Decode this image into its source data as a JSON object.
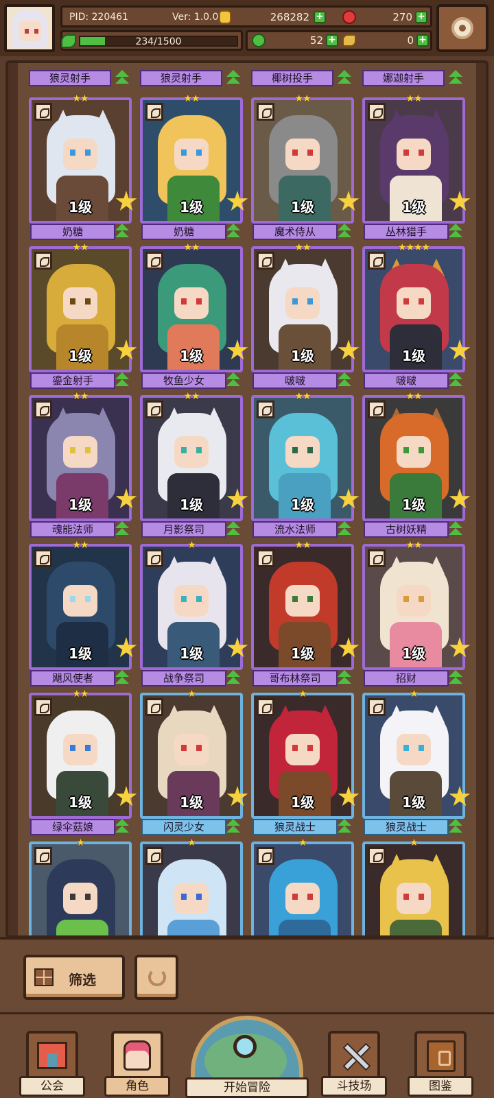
{
  "hud": {
    "pid": "PID: 220461",
    "version": "Ver: 1.0.0.0",
    "gold": "268282",
    "gems": "270",
    "xp_text": "234/1500",
    "xp_fraction": 0.156,
    "clover": "52",
    "keys": "0"
  },
  "top_strip": [
    "狼灵射手",
    "狼灵射手",
    "椰树投手",
    "娜迦射手"
  ],
  "cards": [
    {
      "name": "奶糖",
      "level": "1级",
      "stars": "★★",
      "rarity": "purple",
      "hair": "#dfe6f0",
      "body": "#6a4a38",
      "eye": "#3a9ad9",
      "ear": "#dfe6f0",
      "bg": "#5a4030"
    },
    {
      "name": "奶糖",
      "level": "1级",
      "stars": "★★",
      "rarity": "purple",
      "hair": "#f0c45a",
      "body": "#3f8a3a",
      "eye": "#3a9ad9",
      "ear": "",
      "bg": "#2e4d6a"
    },
    {
      "name": "魔术侍从",
      "level": "1级",
      "stars": "★★",
      "rarity": "purple",
      "hair": "#8a8a8a",
      "body": "#3c6a62",
      "eye": "#d23a3a",
      "ear": "",
      "bg": "#6a5a48"
    },
    {
      "name": "丛林猎手",
      "level": "1级",
      "stars": "★★",
      "rarity": "purple",
      "hair": "#5a3a6a",
      "body": "#efe4d4",
      "eye": "#d23a3a",
      "ear": "#5a3a6a",
      "bg": "#4a3a4a"
    },
    {
      "name": "鎏金射手",
      "level": "1级",
      "stars": "★★",
      "rarity": "purple",
      "hair": "#d8ac3a",
      "body": "#b8862a",
      "eye": "#6a4a12",
      "ear": "",
      "bg": "#5a4a2a"
    },
    {
      "name": "牧鱼少女",
      "level": "1级",
      "stars": "★★",
      "rarity": "purple",
      "hair": "#3a9a7a",
      "body": "#e07a5a",
      "eye": "#d23a3a",
      "ear": "",
      "bg": "#2e3a52"
    },
    {
      "name": "啵啵",
      "level": "1级",
      "stars": "★★",
      "rarity": "purple",
      "hair": "#e8e8ee",
      "body": "#6a5038",
      "eye": "#3a9ad9",
      "ear": "#e8e8ee",
      "bg": "#4a3a30"
    },
    {
      "name": "啵啵",
      "level": "1级",
      "stars": "★★★★",
      "rarity": "purple",
      "hair": "#c23a4a",
      "body": "#2e2e3a",
      "eye": "#d23a3a",
      "ear": "#d89a3a",
      "bg": "#3a4a6a"
    },
    {
      "name": "魂能法师",
      "level": "1级",
      "stars": "★★",
      "rarity": "purple",
      "hair": "#8a86b0",
      "body": "#7a3a6a",
      "eye": "#e0c23a",
      "ear": "#8a86b0",
      "bg": "#3a3050"
    },
    {
      "name": "月影祭司",
      "level": "1级",
      "stars": "★★",
      "rarity": "purple",
      "hair": "#e8eaf0",
      "body": "#2e2e3a",
      "eye": "#3ab0a0",
      "ear": "#e8eaf0",
      "bg": "#3a3a4a"
    },
    {
      "name": "流水法师",
      "level": "1级",
      "stars": "★★",
      "rarity": "purple",
      "hair": "#5ac0d8",
      "body": "#4aa0c0",
      "eye": "#2a6a4a",
      "ear": "",
      "bg": "#3a5a6a"
    },
    {
      "name": "古树妖精",
      "level": "1级",
      "stars": "★★",
      "rarity": "purple",
      "hair": "#d86a2a",
      "body": "#3a7a3a",
      "eye": "#3a9a3a",
      "ear": "#a86a3a",
      "bg": "#3a3a3a"
    },
    {
      "name": "飓风使者",
      "level": "1级",
      "stars": "★★",
      "rarity": "purple",
      "hair": "#2e4a6a",
      "body": "#1e2e44",
      "eye": "#9ad8f0",
      "ear": "",
      "bg": "#22344a"
    },
    {
      "name": "战争祭司",
      "level": "1级",
      "stars": "★",
      "rarity": "purple",
      "hair": "#e8e4ee",
      "body": "#3a5a7a",
      "eye": "#3ab0c0",
      "ear": "#e8e4ee",
      "bg": "#2e3e5a"
    },
    {
      "name": "哥布林祭司",
      "level": "1级",
      "stars": "★★",
      "rarity": "purple",
      "hair": "#c23a2a",
      "body": "#7a4a2a",
      "eye": "#3a7a3a",
      "ear": "",
      "bg": "#3a2a2a"
    },
    {
      "name": "招财",
      "level": "1级",
      "stars": "★★",
      "rarity": "purple",
      "hair": "#f0e4d0",
      "body": "#e88aa0",
      "eye": "#d89a3a",
      "ear": "#f0e4d0",
      "bg": "#5a4a4a"
    },
    {
      "name": "绿伞菇娘",
      "level": "1级",
      "stars": "★★",
      "rarity": "purple",
      "hair": "#efefef",
      "body": "#3a4a3a",
      "eye": "#3a7ad8",
      "ear": "",
      "bg": "#4a3a2a"
    },
    {
      "name": "闪灵少女",
      "level": "1级",
      "stars": "★",
      "rarity": "blue",
      "hair": "#e8d8c0",
      "body": "#6a3a5a",
      "eye": "#d23a3a",
      "ear": "#e8d8c0",
      "bg": "#4a3a30"
    },
    {
      "name": "狼灵战士",
      "level": "1级",
      "stars": "★",
      "rarity": "blue",
      "hair": "#c2243a",
      "body": "#7a4a2a",
      "eye": "#d23a3a",
      "ear": "#c2243a",
      "bg": "#3a2a2a"
    },
    {
      "name": "狼灵战士",
      "level": "1级",
      "stars": "★",
      "rarity": "blue",
      "hair": "#f4f4f8",
      "body": "#5a4a3a",
      "eye": "#3ab0d8",
      "ear": "#f4f4f8",
      "bg": "#3a4a6a"
    },
    {
      "name": "",
      "level": "",
      "stars": "★",
      "rarity": "blue",
      "hair": "#2e3a5a",
      "body": "#6ac04a",
      "eye": "#3a3a3a",
      "ear": "",
      "bg": "#4a5a6a"
    },
    {
      "name": "",
      "level": "",
      "stars": "★",
      "rarity": "blue",
      "hair": "#cfe4f4",
      "body": "#5aa0d8",
      "eye": "#3a6ad8",
      "ear": "",
      "bg": "#3a3a4a"
    },
    {
      "name": "",
      "level": "",
      "stars": "★",
      "rarity": "blue",
      "hair": "#3aa0d8",
      "body": "#2e6a9a",
      "eye": "#d23a3a",
      "ear": "",
      "bg": "#3a4a6a"
    },
    {
      "name": "",
      "level": "",
      "stars": "★",
      "rarity": "blue",
      "hair": "#e8c24a",
      "body": "#4a6a3a",
      "eye": "#d23a3a",
      "ear": "#e8c24a",
      "bg": "#3a2a2a"
    }
  ],
  "filter": {
    "label": "筛选"
  },
  "nav": {
    "guild": "公会",
    "character": "角色",
    "adventure": "开始冒险",
    "arena": "斗技场",
    "codex": "图鉴"
  }
}
